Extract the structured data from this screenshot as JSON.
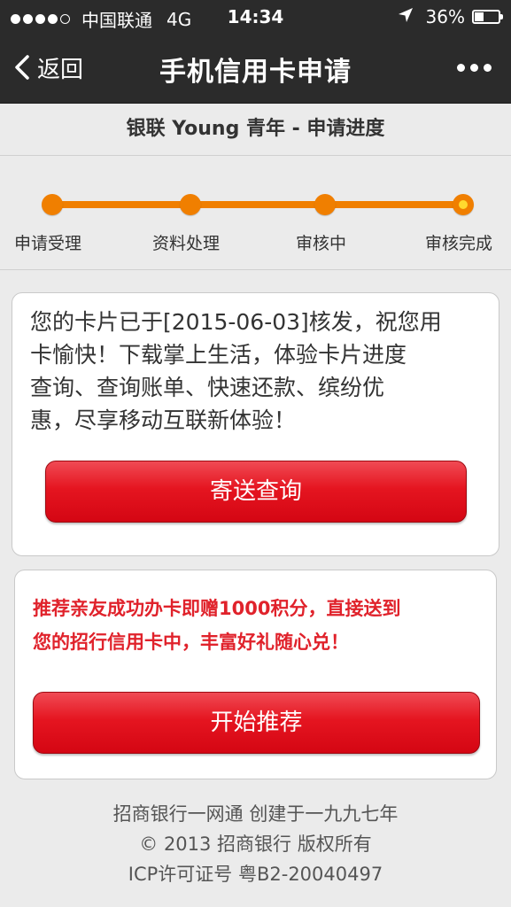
{
  "statusbar": {
    "carrier": "中国联通",
    "network": "4G",
    "time": "14:34",
    "battery_text": "36%",
    "battery_level": 0.36,
    "signal_bars_filled": 4,
    "signal_bars_total": 5
  },
  "navbar": {
    "back_label": "返回",
    "title": "手机信用卡申请"
  },
  "subtitle": "银联 Young 青年 - 申请进度",
  "progress": {
    "steps": [
      "申请受理",
      "资料处理",
      "审核中",
      "审核完成"
    ],
    "current_step": 4
  },
  "card1": {
    "message_lines": [
      "您的卡片已于[2015-06-03]核发，祝您用",
      "卡愉快！下载掌上生活，体验卡片进度",
      "查询、查询账单、快速还款、缤纷优",
      "惠，尽享移动互联新体验！"
    ],
    "button_label": "寄送查询"
  },
  "card2": {
    "promo_lines": [
      "推荐亲友成功办卡即赠1000积分，直接送到",
      "您的招行信用卡中，丰富好礼随心兑！"
    ],
    "button_label": "开始推荐"
  },
  "footer": {
    "line1": "招商银行一网通 创建于一九九七年",
    "line2": "© 2013 招商银行 版权所有",
    "line3": "ICP许可证号 粤B2-20040497"
  },
  "colors": {
    "bar_bg": "#2b2b2b",
    "accent_orange": "#f07f00",
    "current_dot": "#ffd92e",
    "button_red": "#e51520",
    "promo_red": "#e0222b"
  }
}
